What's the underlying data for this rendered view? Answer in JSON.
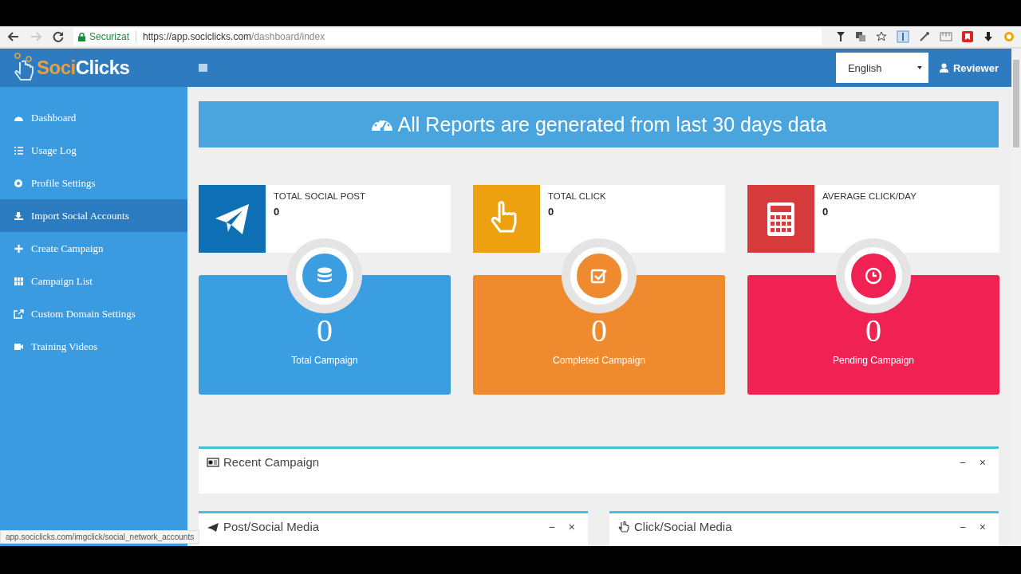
{
  "browser": {
    "security": "Securizat",
    "url_host": "https://app.sociclicks.com",
    "url_path": "/dashboard/index",
    "status_url": "app.sociclicks.com/imgclick/social_network_accounts"
  },
  "header": {
    "logo_left": "Soci",
    "logo_right": "Clicks",
    "language": "English",
    "user": "Reviewer"
  },
  "sidebar": {
    "items": [
      {
        "label": "Dashboard",
        "selected": false
      },
      {
        "label": "Usage Log",
        "selected": false
      },
      {
        "label": "Profile Settings",
        "selected": false
      },
      {
        "label": "Import Social Accounts",
        "selected": true
      },
      {
        "label": "Create Campaign",
        "selected": false
      },
      {
        "label": "Campaign List",
        "selected": false
      },
      {
        "label": "Custom Domain Settings",
        "selected": false
      },
      {
        "label": "Training Videos",
        "selected": false
      }
    ]
  },
  "banner": "All Reports are generated from last 30 days data",
  "stats": [
    {
      "label": "TOTAL SOCIAL POST",
      "value": "0",
      "color": "#0e6fb5"
    },
    {
      "label": "TOTAL CLICK",
      "value": "0",
      "color": "#eda10f"
    },
    {
      "label": "AVERAGE CLICK/DAY",
      "value": "0",
      "color": "#d73a3a"
    }
  ],
  "tiles": [
    {
      "value": "0",
      "label": "Total Campaign",
      "color": "#3a9ee0"
    },
    {
      "value": "0",
      "label": "Completed Campaign",
      "color": "#f08a2e"
    },
    {
      "value": "0",
      "label": "Pending Campaign",
      "color": "#ef2253"
    }
  ],
  "panels": [
    {
      "title": "Recent Campaign",
      "minimize": "−",
      "close": "×"
    },
    {
      "title": "Post/Social Media",
      "minimize": "−",
      "close": "×"
    },
    {
      "title": "Click/Social Media",
      "minimize": "−",
      "close": "×"
    }
  ]
}
